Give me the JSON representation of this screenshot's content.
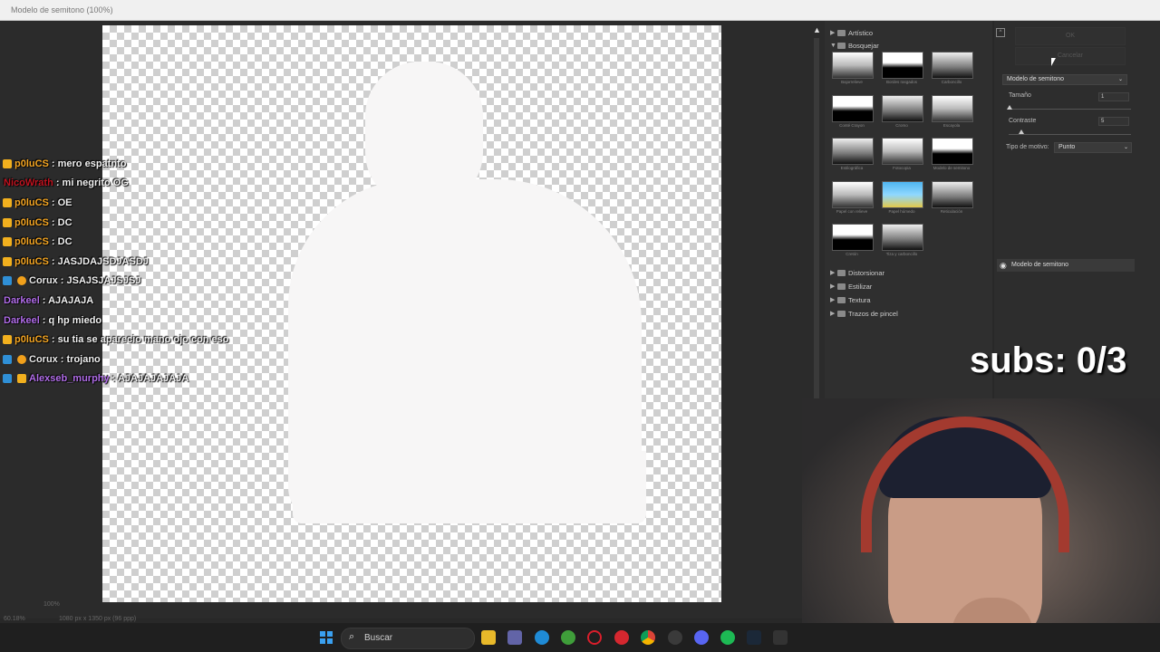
{
  "window": {
    "title": "Modelo de semitono (100%)"
  },
  "chat": [
    {
      "user": "p0luCS",
      "user_color": "#f5a623",
      "badges": [
        "gold"
      ],
      "message": ": mero espatnto"
    },
    {
      "user": "NicoWrath",
      "user_color": "#c1121f",
      "badges": [],
      "message": ": mi negrito OG"
    },
    {
      "user": "p0luCS",
      "user_color": "#f5a623",
      "badges": [
        "gold"
      ],
      "message": ": OE"
    },
    {
      "user": "p0luCS",
      "user_color": "#f5a623",
      "badges": [
        "gold"
      ],
      "message": ": DC"
    },
    {
      "user": "p0luCS",
      "user_color": "#f5a623",
      "badges": [
        "gold"
      ],
      "message": ": DC"
    },
    {
      "user": "p0luCS",
      "user_color": "#f5a623",
      "badges": [
        "gold"
      ],
      "message": ": JASJDAJSDJASDJ"
    },
    {
      "user": "Corux",
      "user_color": "#e8e8e8",
      "badges": [
        "blue",
        "orange"
      ],
      "message": ": JSAJSJAJSJSJ"
    },
    {
      "user": "Darkeel",
      "user_color": "#b06ce8",
      "badges": [],
      "message": ": AJAJAJA"
    },
    {
      "user": "Darkeel",
      "user_color": "#b06ce8",
      "badges": [],
      "message": ": q hp miedo"
    },
    {
      "user": "p0luCS",
      "user_color": "#f5a623",
      "badges": [
        "gold"
      ],
      "message": ": su tia se aparecio mano ojo con eso"
    },
    {
      "user": "Corux",
      "user_color": "#e8e8e8",
      "badges": [
        "blue",
        "orange"
      ],
      "message": ": trojano"
    },
    {
      "user": "Alexseb_murphy",
      "user_color": "#b06ce8",
      "badges": [
        "blue",
        "gold"
      ],
      "message": ": AJAJAJAJAJA"
    }
  ],
  "gallery": {
    "categories_top": [
      {
        "label": "Artístico",
        "expanded": false
      },
      {
        "label": "Bosquejar",
        "expanded": true
      }
    ],
    "thumbnails": [
      {
        "label": "Bajorrelieve"
      },
      {
        "label": "Bordes rasgados"
      },
      {
        "label": "Carboncillo"
      },
      {
        "label": "Conté Crayon"
      },
      {
        "label": "Cromo"
      },
      {
        "label": "Escayola"
      },
      {
        "label": "Estilográfica"
      },
      {
        "label": "Fotocopia"
      },
      {
        "label": "Modelo de semitono"
      },
      {
        "label": "Papel con relieve"
      },
      {
        "label": "Papel húmedo"
      },
      {
        "label": "Reticulación"
      },
      {
        "label": "Cretón"
      },
      {
        "label": "Tiza y carboncillo"
      }
    ],
    "categories_bottom": [
      {
        "label": "Distorsionar"
      },
      {
        "label": "Estilizar"
      },
      {
        "label": "Textura"
      },
      {
        "label": "Trazos de pincel"
      }
    ]
  },
  "settings": {
    "ok_label": "OK",
    "cancel_label": "Cancelar",
    "filter_select": "Modelo de semitono",
    "size_label": "Tamaño",
    "size_value": "1",
    "contrast_label": "Contraste",
    "contrast_value": "5",
    "pattern_label": "Tipo de motivo:",
    "pattern_value": "Punto",
    "layer_name": "Modelo de semitono"
  },
  "status": {
    "zoom": "100%",
    "zoom_left": "60.18%",
    "doc_info": "1080 px x 1350 px (96 ppp)"
  },
  "overlay": {
    "subs_text": "subs: 0/3"
  },
  "taskbar": {
    "search_placeholder": "Buscar",
    "icons": [
      "windows-icon",
      "file-explorer-icon",
      "teams-icon",
      "edge-icon",
      "xbox-icon",
      "opera-icon",
      "app-icon",
      "chrome-icon",
      "obs-icon",
      "discord-icon",
      "spotify-icon",
      "steam-icon",
      "epic-games-icon"
    ]
  }
}
